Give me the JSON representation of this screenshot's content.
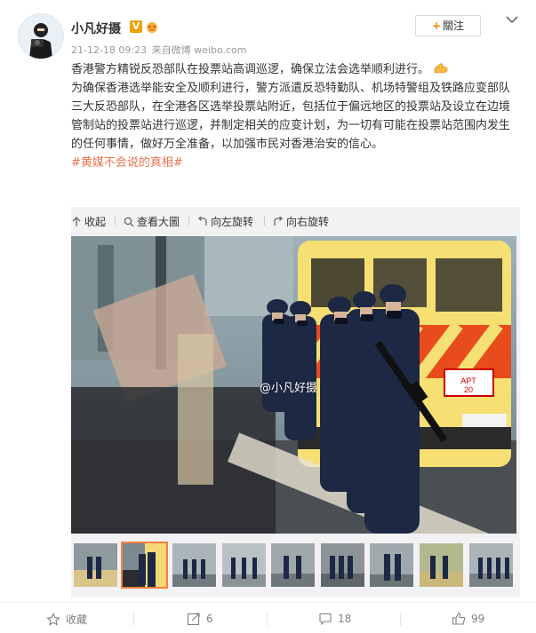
{
  "post": {
    "username": "小凡好摄",
    "verified_badge": "V",
    "level_badge_icon": "level-badge-icon",
    "timestamp": "21-12-18 09:23",
    "source": "来自微博 weibo.com",
    "follow_label": "關注",
    "text_line1": "香港警方精锐反恐部队在投票站高调巡逻，确保立法会选举顺利进行。",
    "text_body": "为确保香港选举能安全及顺利进行，警方派遣反恐特勤队、机场特警组及铁路应变部队三大反恐部队，在全港各区选举投票站附近，包括位于偏远地区的投票站及设立在边境管制站的投票站进行巡逻，并制定相关的应变计划，为一切有可能在投票站范围内发生的任何事情，做好万全准备，以加强市民对香港治安的信心。",
    "hashtag": "#黄媒不会说的真相#"
  },
  "media": {
    "toolbar": {
      "collapse": "收起",
      "view_large": "查看大圖",
      "rotate_left": "向左旋转",
      "rotate_right": "向右旋转"
    },
    "watermark": "@小凡好摄",
    "thumbnail_count": 9
  },
  "actions": {
    "favorite": "收藏",
    "repost": "6",
    "comment": "18",
    "like": "99"
  },
  "colors": {
    "accent": "#ff8200",
    "hashtag": "#eb7350",
    "thumb_active": "#fa7d3c"
  }
}
